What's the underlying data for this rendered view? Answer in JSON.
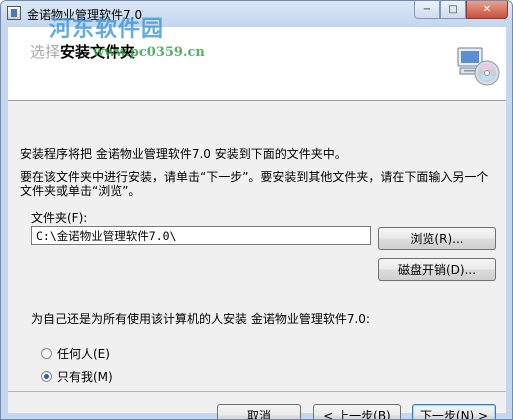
{
  "window": {
    "title": "金诺物业管理软件7.0",
    "watermark_text": "河东软件园",
    "watermark_url": "www.pc0359.cn",
    "controls": {
      "minimize": "−",
      "maximize": "□",
      "close": "✕"
    }
  },
  "banner": {
    "title_prefix": "选择",
    "title": "安装文件夹"
  },
  "body": {
    "line1": "安装程序将把 金诺物业管理软件7.0 安装到下面的文件夹中。",
    "line2": "要在该文件夹中进行安装，请单击“下一步”。要安装到其他文件夹，请在下面输入另一个文件夹或单击“浏览”。",
    "folder_label": "文件夹(F):",
    "folder_value": "C:\\金诺物业管理软件7.0\\",
    "browse_label": "浏览(R)...",
    "disk_cost_label": "磁盘开销(D)...",
    "question": "为自己还是为所有使用该计算机的人安装 金诺物业管理软件7.0:",
    "options": [
      {
        "label": "任何人(E)",
        "selected": false
      },
      {
        "label": "只有我(M)",
        "selected": true
      }
    ]
  },
  "footer": {
    "cancel_label": "取消",
    "prev_label": "< 上一步(B)",
    "next_label": "下一步(N) >"
  },
  "colors": {
    "titlebar": "#c2d6ee",
    "dialog_bg": "#f0f0f0",
    "watermark_blue": "#2f8fd6",
    "watermark_green": "#39a34f"
  },
  "icons": [
    "app-icon",
    "computer-cd-icon",
    "radio-icon"
  ]
}
